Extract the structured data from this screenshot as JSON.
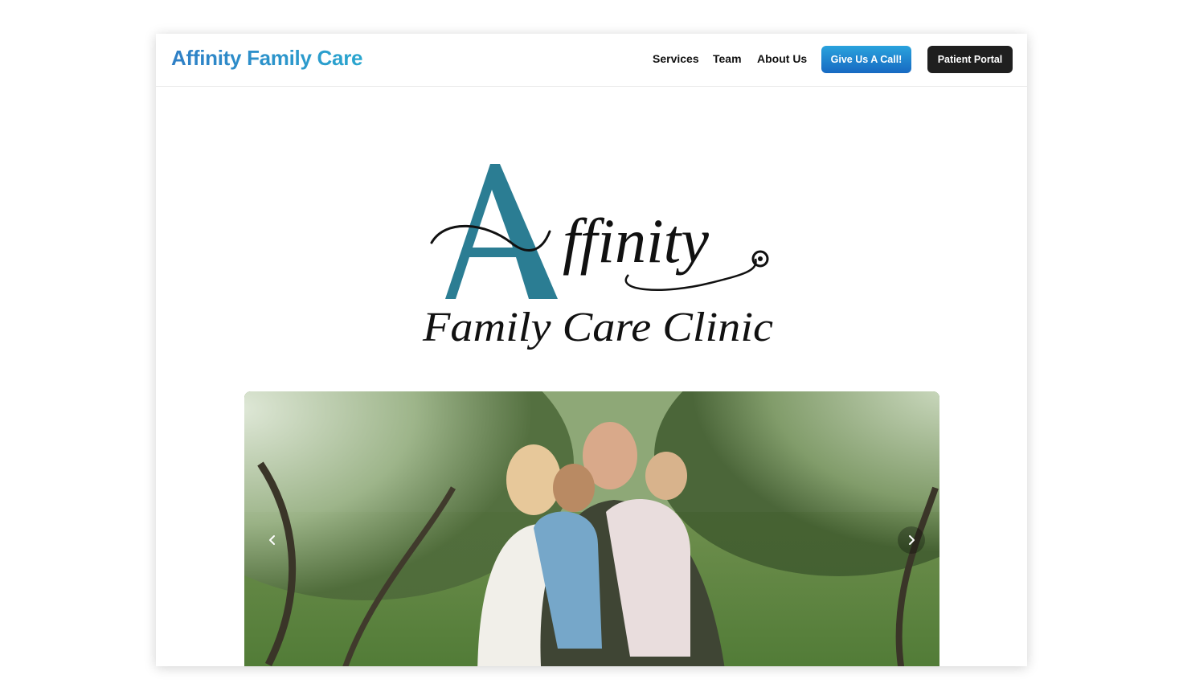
{
  "navbar": {
    "brand": "Affinity Family Care",
    "links": [
      "Services",
      "Team",
      "About Us"
    ],
    "call_button": "Give Us A Call!",
    "portal_button": "Patient Portal"
  },
  "logo": {
    "initial": "A",
    "word": "ffinity",
    "subtitle": "Family Care Clinic",
    "accent_color": "#2b7d93"
  },
  "carousel": {
    "prev_icon": "chevron-left-icon",
    "next_icon": "chevron-right-icon"
  },
  "colors": {
    "brand_gradient_start": "#2f7fc6",
    "brand_gradient_end": "#2aa6cf",
    "call_button": "#1769c2",
    "portal_button": "#1f1f1f"
  }
}
